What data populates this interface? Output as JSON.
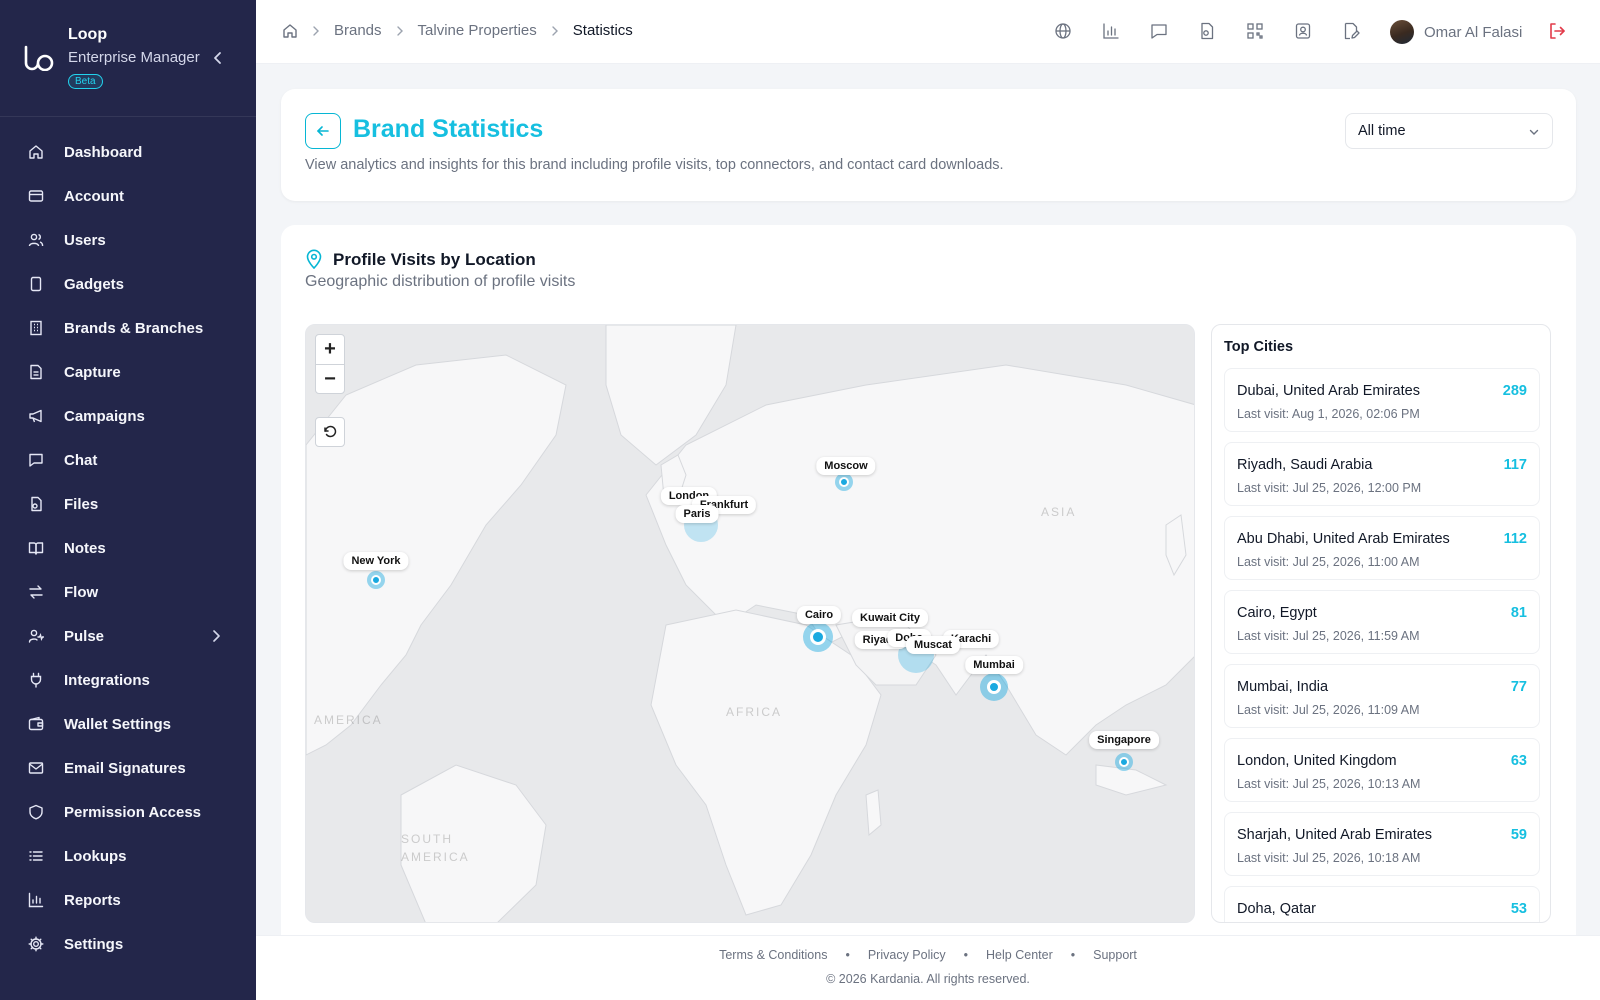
{
  "app": {
    "name": "Loop",
    "subtitle": "Enterprise Manager",
    "badge": "Beta"
  },
  "sidebar": {
    "items": [
      {
        "label": "Dashboard",
        "icon": "home-icon"
      },
      {
        "label": "Account",
        "icon": "card-icon"
      },
      {
        "label": "Users",
        "icon": "users-icon"
      },
      {
        "label": "Gadgets",
        "icon": "device-icon"
      },
      {
        "label": "Brands & Branches",
        "icon": "building-icon"
      },
      {
        "label": "Capture",
        "icon": "document-icon"
      },
      {
        "label": "Campaigns",
        "icon": "megaphone-icon"
      },
      {
        "label": "Chat",
        "icon": "chat-icon"
      },
      {
        "label": "Files",
        "icon": "files-icon"
      },
      {
        "label": "Notes",
        "icon": "book-icon"
      },
      {
        "label": "Flow",
        "icon": "arrows-icon"
      },
      {
        "label": "Pulse",
        "icon": "user-pulse-icon"
      },
      {
        "label": "Integrations",
        "icon": "plug-icon"
      },
      {
        "label": "Wallet Settings",
        "icon": "wallet-icon"
      },
      {
        "label": "Email Signatures",
        "icon": "mail-icon"
      },
      {
        "label": "Permission Access",
        "icon": "shield-icon"
      },
      {
        "label": "Lookups",
        "icon": "list-icon"
      },
      {
        "label": "Reports",
        "icon": "bar-chart-icon"
      },
      {
        "label": "Settings",
        "icon": "gear-icon"
      }
    ]
  },
  "header": {
    "breadcrumb": [
      "Brands",
      "Talvine Properties",
      "Statistics"
    ],
    "user_name": "Omar Al Falasi"
  },
  "page": {
    "title": "Brand Statistics",
    "description": "View analytics and insights for this brand including profile visits, top connectors, and contact card downloads.",
    "range": "All time"
  },
  "map_section": {
    "title": "Profile Visits by Location",
    "subtitle": "Geographic distribution of profile visits",
    "zoom_in": "+",
    "zoom_out": "−",
    "region_labels": [
      "AMERICA",
      "AFRICA",
      "ASIA",
      "SOUTH AMERICA"
    ],
    "labels": [
      "Moscow",
      "London",
      "Frankfurt",
      "Paris",
      "New York",
      "Cairo",
      "Kuwait City",
      "Riyadh",
      "Doha",
      "Muscat",
      "Karachi",
      "Mumbai",
      "Singapore"
    ]
  },
  "top_cities": {
    "title": "Top Cities",
    "items": [
      {
        "name": "Dubai, United Arab Emirates",
        "last_visit": "Last visit: Aug 1, 2026, 02:06 PM",
        "count": "289"
      },
      {
        "name": "Riyadh, Saudi Arabia",
        "last_visit": "Last visit: Jul 25, 2026, 12:00 PM",
        "count": "117"
      },
      {
        "name": "Abu Dhabi, United Arab Emirates",
        "last_visit": "Last visit: Jul 25, 2026, 11:00 AM",
        "count": "112"
      },
      {
        "name": "Cairo, Egypt",
        "last_visit": "Last visit: Jul 25, 2026, 11:59 AM",
        "count": "81"
      },
      {
        "name": "Mumbai, India",
        "last_visit": "Last visit: Jul 25, 2026, 11:09 AM",
        "count": "77"
      },
      {
        "name": "London, United Kingdom",
        "last_visit": "Last visit: Jul 25, 2026, 10:13 AM",
        "count": "63"
      },
      {
        "name": "Sharjah, United Arab Emirates",
        "last_visit": "Last visit: Jul 25, 2026, 10:18 AM",
        "count": "59"
      },
      {
        "name": "Doha, Qatar",
        "last_visit": "",
        "count": "53"
      }
    ]
  },
  "footer": {
    "links": [
      "Terms & Conditions",
      "Privacy Policy",
      "Help Center",
      "Support"
    ],
    "copyright": "© 2026 Kardania. All rights reserved."
  },
  "colors": {
    "sidebar_bg": "#23264a",
    "accent": "#16bfe0",
    "logout": "#e23b4a",
    "marker": "#1aa9e0"
  }
}
